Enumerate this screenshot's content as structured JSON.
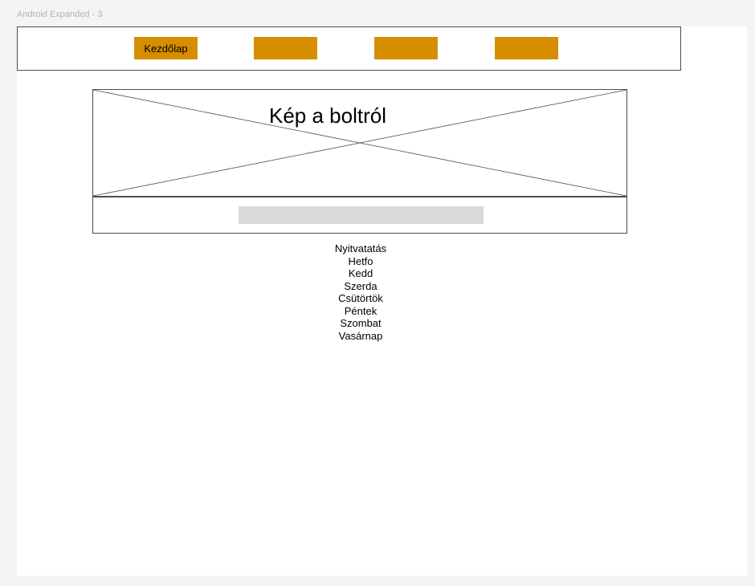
{
  "frame": {
    "label": "Android Expanded - 3"
  },
  "nav": {
    "buttons": [
      {
        "label": "Kezdőlap"
      },
      {
        "label": ""
      },
      {
        "label": ""
      },
      {
        "label": ""
      }
    ]
  },
  "hero": {
    "caption": "Kép a boltról"
  },
  "search": {
    "value": ""
  },
  "hours": {
    "title": "Nyitvatatás",
    "days": [
      "Hetfo",
      "Kedd",
      "Szerda",
      "Csütörtök",
      "Péntek",
      "Szombat",
      "Vasárnap"
    ]
  },
  "colors": {
    "accent": "#d68e00",
    "input_bg": "#d9d9d9",
    "border": "#4d4d4d",
    "canvas_bg": "#f4f4f4"
  }
}
